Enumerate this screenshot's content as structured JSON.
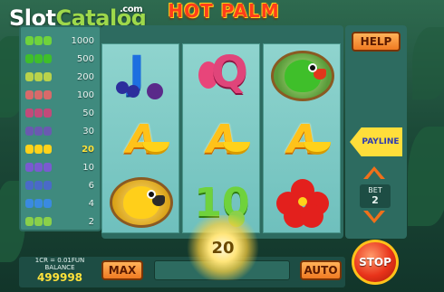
{
  "watermark": {
    "brand_part1": "Slot",
    "brand_part2": "Catalog",
    "suffix": ".com"
  },
  "game": {
    "title": "HOT PALM"
  },
  "paytable": [
    {
      "value": "1000",
      "icon": "palm-tree-icon",
      "color": "#6fd23c",
      "active": false
    },
    {
      "value": "500",
      "icon": "green-parrot-icon",
      "color": "#3fbf2a",
      "active": false
    },
    {
      "value": "200",
      "icon": "yellow-parrot-icon",
      "color": "#b9d24a",
      "active": false
    },
    {
      "value": "100",
      "icon": "hibiscus-icon",
      "color": "#d86a6a",
      "active": false
    },
    {
      "value": "50",
      "icon": "dragonfruit-icon",
      "color": "#c24a7a",
      "active": false
    },
    {
      "value": "30",
      "icon": "passionfruit-icon",
      "color": "#6a5ab0",
      "active": false
    },
    {
      "value": "20",
      "icon": "banana-icon",
      "color": "#ffd21a",
      "active": true
    },
    {
      "value": "10",
      "icon": "plum-icon",
      "color": "#7a5ad0",
      "active": false
    },
    {
      "value": "6",
      "icon": "grape-icon",
      "color": "#4a6ac8",
      "active": false
    },
    {
      "value": "4",
      "icon": "blueberry-icon",
      "color": "#3a8ae0",
      "active": false
    },
    {
      "value": "2",
      "icon": "lime-icon",
      "color": "#8ad04a",
      "active": false
    }
  ],
  "reels": [
    [
      {
        "symbol": "J",
        "icon": "blueberry-icon"
      },
      {
        "symbol": "A",
        "icon": "banana-icon"
      },
      {
        "symbol": "",
        "icon": "yellow-parrot-icon"
      }
    ],
    [
      {
        "symbol": "Q",
        "icon": "dragonfruit-icon"
      },
      {
        "symbol": "A",
        "icon": "banana-icon"
      },
      {
        "symbol": "10",
        "icon": "lime-icon"
      }
    ],
    [
      {
        "symbol": "",
        "icon": "green-parrot-icon"
      },
      {
        "symbol": "A",
        "icon": "banana-icon"
      },
      {
        "symbol": "",
        "icon": "hibiscus-icon"
      }
    ]
  ],
  "controls": {
    "help_label": "HELP",
    "payline_label": "PAYLINE",
    "bet_label": "BET",
    "bet_value": "2",
    "max_label": "MAX",
    "auto_label": "AUTO",
    "stop_label": "STOP"
  },
  "balance": {
    "rate": "1CR = 0.01FUN",
    "label": "BALANCE",
    "value": "499998"
  },
  "win": {
    "amount": "20"
  },
  "colors": {
    "frame": "#2d6b60",
    "paytable": "#3f8a7e",
    "button": "#f07a22",
    "highlight": "#ffe23a"
  }
}
